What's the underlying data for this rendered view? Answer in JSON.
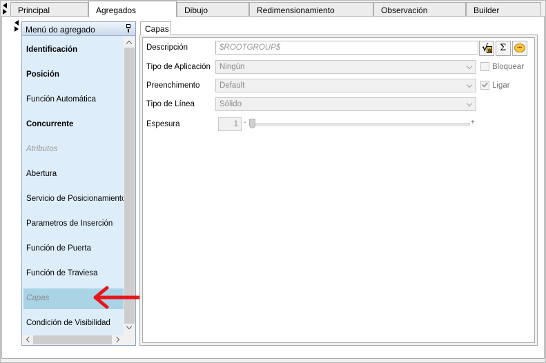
{
  "tabs": [
    {
      "label": "Principal",
      "active": false
    },
    {
      "label": "Agregados",
      "active": true
    },
    {
      "label": "Dibujo",
      "active": false
    },
    {
      "label": "Redimensionamiento",
      "active": false
    },
    {
      "label": "Observación",
      "active": false
    },
    {
      "label": "Builder",
      "active": false
    }
  ],
  "menu": {
    "title": "Menú do agregado",
    "items": [
      {
        "label": "Identificación",
        "style": "bold"
      },
      {
        "label": "Posición",
        "style": "bold"
      },
      {
        "label": "Función Automática",
        "style": "normal"
      },
      {
        "label": "Concurrente",
        "style": "bold"
      },
      {
        "label": "Atributos",
        "style": "disabled"
      },
      {
        "label": "Abertura",
        "style": "normal"
      },
      {
        "label": "Servicio de Posicionamiento",
        "style": "normal"
      },
      {
        "label": "Parametros de Inserción",
        "style": "normal"
      },
      {
        "label": "Función de Puerta",
        "style": "normal"
      },
      {
        "label": "Función de Traviesa",
        "style": "normal"
      },
      {
        "label": "Capas",
        "style": "selected"
      },
      {
        "label": "Condición de Visibilidad",
        "style": "normal"
      }
    ]
  },
  "panel": {
    "tab_label": "Capas",
    "descripcion": {
      "label": "Descripción",
      "value": "$ROOTGROUP$"
    },
    "tipo_aplicacion": {
      "label": "Tipo de Aplicación",
      "value": "Ningún"
    },
    "preenchimento": {
      "label": "Preenchimento",
      "value": "Default"
    },
    "tipo_linea": {
      "label": "Tipo de Línea",
      "value": "Sólido"
    },
    "espesura": {
      "label": "Espesura",
      "value": "1",
      "slider_fraction": 0.0,
      "minus": "-",
      "plus": "+"
    },
    "bloquear": {
      "label": "Bloquear",
      "checked": false
    },
    "ligar": {
      "label": "Ligar",
      "checked": true
    },
    "icons": [
      "formula-icon",
      "sigma-icon",
      "comment-icon"
    ],
    "sigma_glyph": "Σ"
  },
  "colors": {
    "selected_item": "#a9d4e5",
    "menu_background": "#ddeefa",
    "annotation_arrow": "#e8141c"
  }
}
